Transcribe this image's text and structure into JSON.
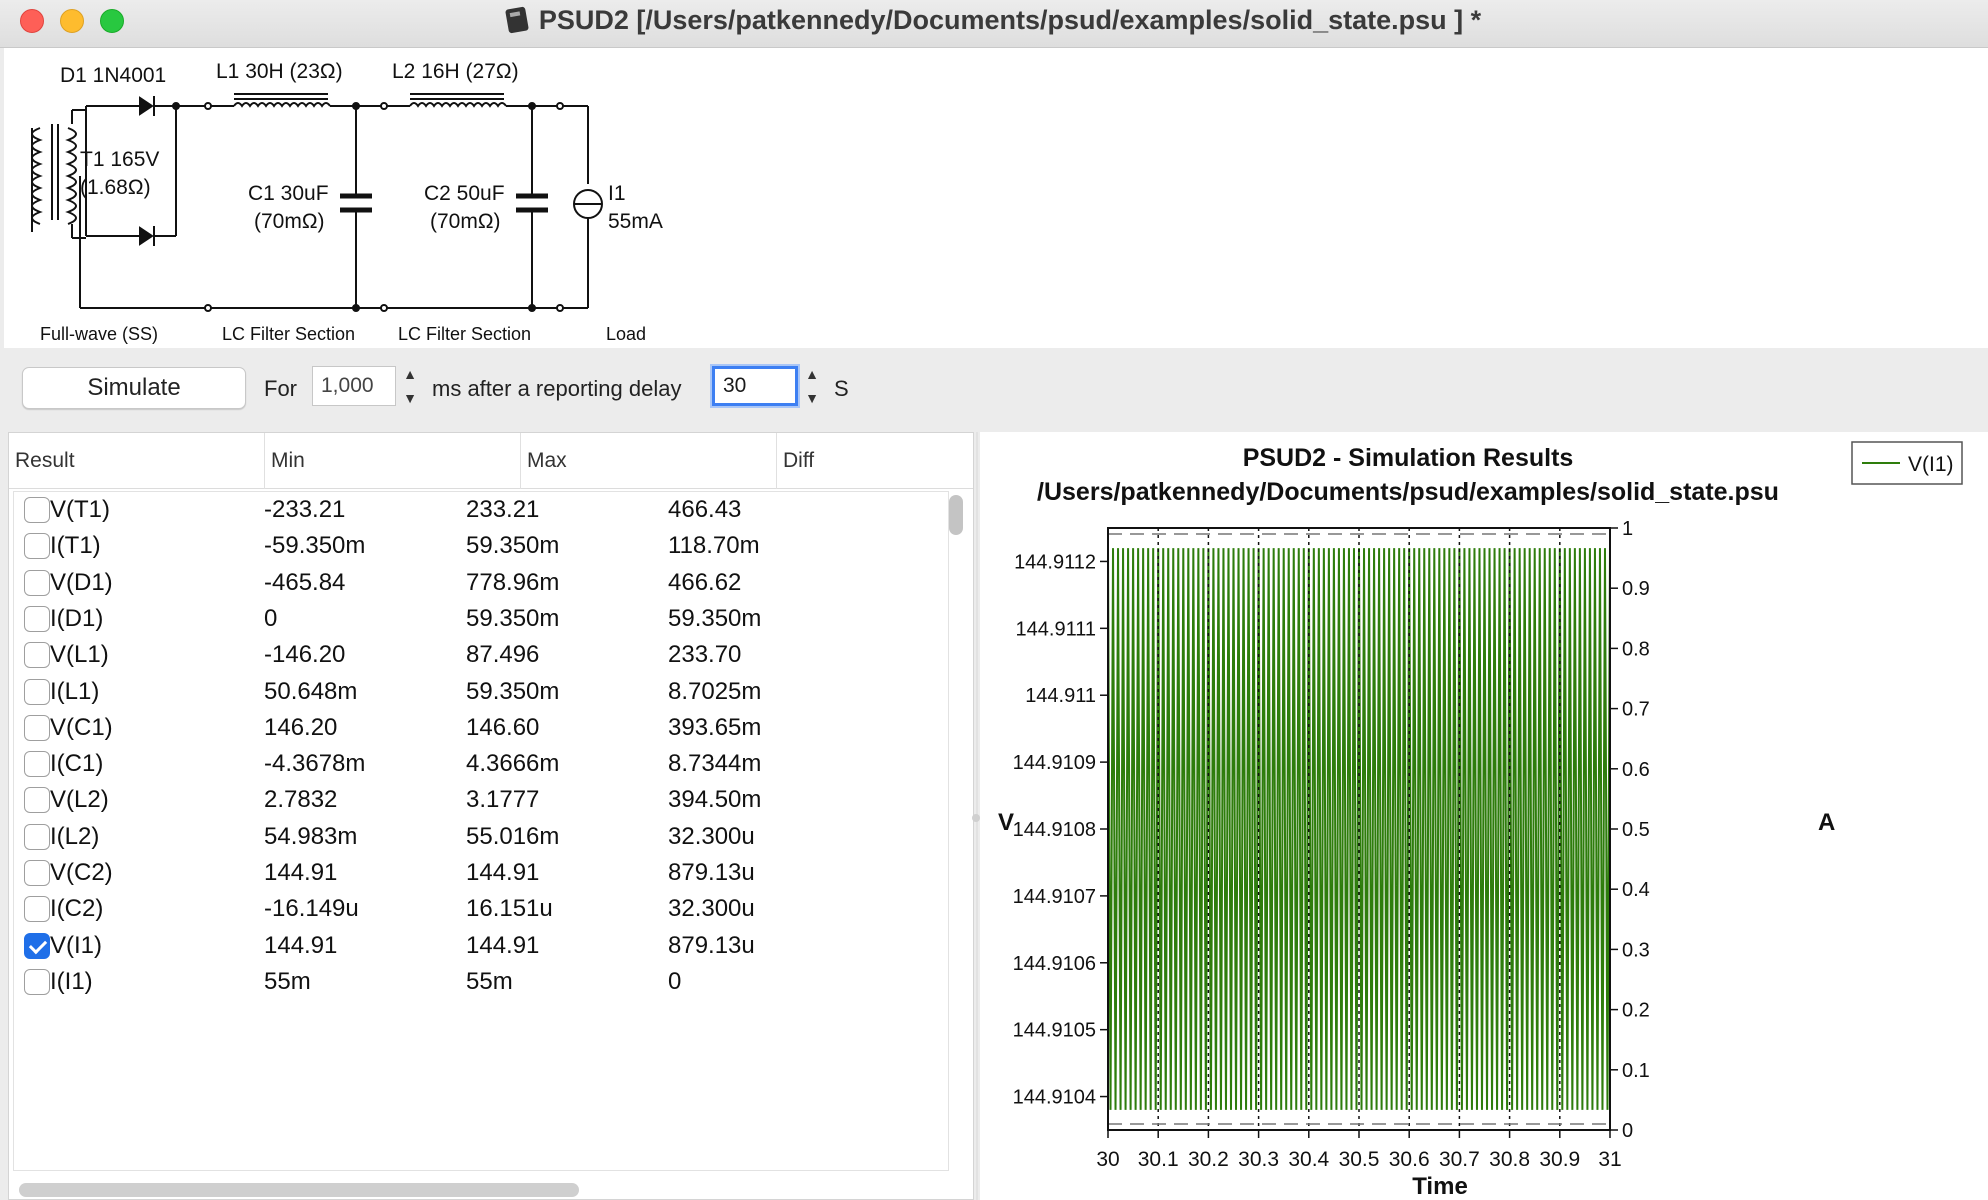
{
  "window": {
    "title": "PSUD2  [/Users/patkennedy/Documents/psud/examples/solid_state.psu ] *"
  },
  "schematic": {
    "d1_label": "D1 1N4001",
    "t1_label_1": "T1 165V",
    "t1_label_2": "(1.68Ω)",
    "l1_label": "L1 30H (23Ω)",
    "l2_label": "L2 16H (27Ω)",
    "c1_label_1": "C1 30uF",
    "c1_label_2": "(70mΩ)",
    "c2_label_1": "C2 50uF",
    "c2_label_2": "(70mΩ)",
    "i1_label_1": "I1",
    "i1_label_2": "55mA",
    "section_rectifier": "Full-wave (SS)",
    "section_lc1": "LC Filter Section",
    "section_lc2": "LC Filter Section",
    "section_load": "Load"
  },
  "controls": {
    "simulate_label": "Simulate",
    "for_label": "For",
    "duration_value": "1,000",
    "ms_label": "ms after a reporting delay",
    "delay_value": "30",
    "s_label": "S"
  },
  "table": {
    "headers": [
      "Result",
      "Min",
      "Max",
      "Diff"
    ],
    "rows": [
      {
        "name": "V(T1)",
        "min": "-233.21",
        "max": "233.21",
        "diff": "466.43",
        "checked": false
      },
      {
        "name": "I(T1)",
        "min": "-59.350m",
        "max": "59.350m",
        "diff": "118.70m",
        "checked": false
      },
      {
        "name": "V(D1)",
        "min": "-465.84",
        "max": "778.96m",
        "diff": "466.62",
        "checked": false
      },
      {
        "name": "I(D1)",
        "min": "0",
        "max": "59.350m",
        "diff": "59.350m",
        "checked": false
      },
      {
        "name": "V(L1)",
        "min": "-146.20",
        "max": "87.496",
        "diff": "233.70",
        "checked": false
      },
      {
        "name": "I(L1)",
        "min": "50.648m",
        "max": "59.350m",
        "diff": "8.7025m",
        "checked": false
      },
      {
        "name": "V(C1)",
        "min": "146.20",
        "max": "146.60",
        "diff": "393.65m",
        "checked": false
      },
      {
        "name": "I(C1)",
        "min": "-4.3678m",
        "max": "4.3666m",
        "diff": "8.7344m",
        "checked": false
      },
      {
        "name": "V(L2)",
        "min": "2.7832",
        "max": "3.1777",
        "diff": "394.50m",
        "checked": false
      },
      {
        "name": "I(L2)",
        "min": "54.983m",
        "max": "55.016m",
        "diff": "32.300u",
        "checked": false
      },
      {
        "name": "V(C2)",
        "min": "144.91",
        "max": "144.91",
        "diff": "879.13u",
        "checked": false
      },
      {
        "name": "I(C2)",
        "min": "-16.149u",
        "max": "16.151u",
        "diff": "32.300u",
        "checked": false
      },
      {
        "name": "V(I1)",
        "min": "144.91",
        "max": "144.91",
        "diff": "879.13u",
        "checked": true
      },
      {
        "name": "I(I1)",
        "min": "55m",
        "max": "55m",
        "diff": "0",
        "checked": false
      }
    ]
  },
  "chart_data": {
    "type": "line",
    "title": "PSUD2 - Simulation Results",
    "subtitle": "/Users/patkennedy/Documents/psud/examples/solid_state.psu",
    "xlabel": "Time",
    "ylabel_left": "V",
    "ylabel_right": "A",
    "xlim": [
      30,
      31
    ],
    "ylim_left": [
      144.91035,
      144.91125
    ],
    "ylim_right": [
      0,
      1
    ],
    "x_ticks": [
      "30",
      "30.1",
      "30.2",
      "30.3",
      "30.4",
      "30.5",
      "30.6",
      "30.7",
      "30.8",
      "30.9",
      "31"
    ],
    "y_ticks_left": [
      "144.9104",
      "144.9105",
      "144.9106",
      "144.9107",
      "144.9108",
      "144.9109",
      "144.911",
      "144.9111",
      "144.9112"
    ],
    "y_ticks_right": [
      "0",
      "0.1",
      "0.2",
      "0.3",
      "0.4",
      "0.5",
      "0.6",
      "0.7",
      "0.8",
      "0.9",
      "1"
    ],
    "grid": true,
    "legend_position": "top-right",
    "series": [
      {
        "name": "V(I1)",
        "color": "#2e7d0c",
        "ripple_hz": 100,
        "min": 144.91038,
        "max": 144.91122
      }
    ]
  }
}
